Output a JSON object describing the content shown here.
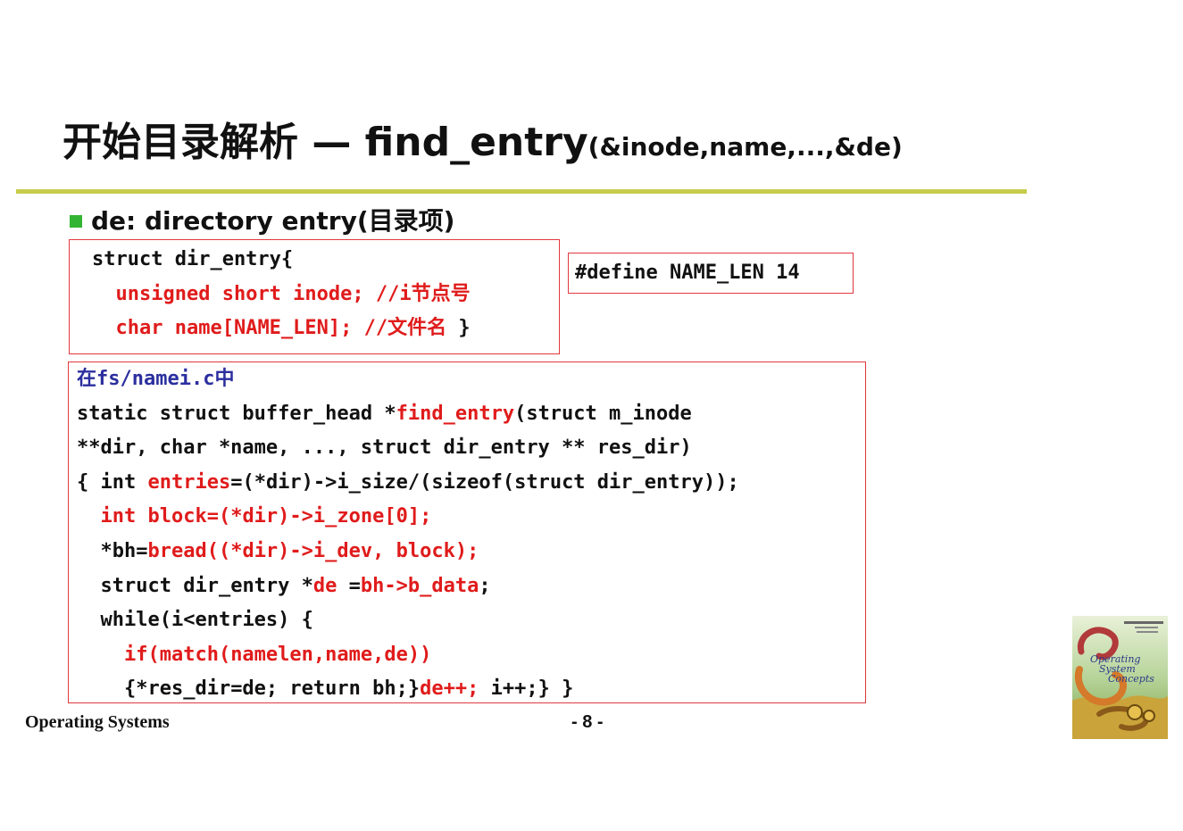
{
  "title": {
    "main": "开始目录解析 — find_entry",
    "args": "(&inode,name,...,&de)"
  },
  "bullet": {
    "text": "de:  directory entry(目录项)"
  },
  "struct_box": {
    "line1": "struct dir_entry{",
    "line2": "unsigned short inode; //i节点号",
    "line3_code": "char name[NAME_LEN]; //文件名",
    "line3_brace": " }"
  },
  "define_box": {
    "text": "#define NAME_LEN 14"
  },
  "fn_box": {
    "location": "在fs/namei.c中",
    "l2_a": "static struct buffer_head *",
    "l2_b": "find_entry",
    "l2_c": "(struct m_inode",
    "l3": "**dir, char *name, ..., struct dir_entry ** res_dir)",
    "l4_a": "{ int ",
    "l4_b": "entries",
    "l4_c": "=(*dir)->i_size/(sizeof(struct dir_entry));",
    "l5": "int block=(*dir)->i_zone[0];",
    "l6_a": "*bh=",
    "l6_b": "bread((*dir)->i_dev, block);",
    "l7_a": "struct dir_entry *",
    "l7_b": "de",
    "l7_c": " =",
    "l7_d": "bh->b_data",
    "l7_e": ";",
    "l8": "while(i<entries) {",
    "l9": "if(match(namelen,name,de))",
    "l10_a": "{*res_dir=de; return bh;}",
    "l10_b": "de++;",
    "l10_c": " i++;} }"
  },
  "footer": {
    "course": "Operating Systems",
    "page": "- 8 -"
  },
  "book_cover": {
    "title_lines": [
      "Operating",
      "System",
      "Concepts"
    ]
  },
  "colors": {
    "accent_rule": "#c6cc4a",
    "bullet": "#33b533",
    "box_border": "#e0393e",
    "code_red": "#e01b1b",
    "code_blue": "#2b2f9e"
  }
}
